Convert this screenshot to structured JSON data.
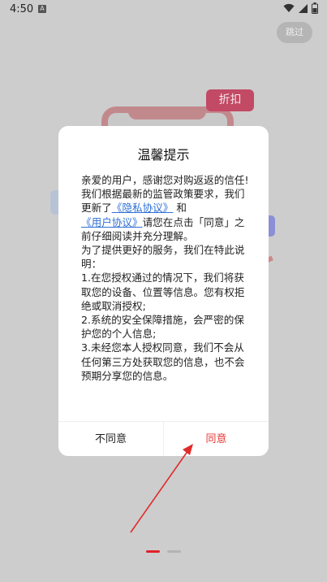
{
  "status_bar": {
    "time": "4:50",
    "notification_icon": "A"
  },
  "skip_label": "跳过",
  "discount_badge": "折扣",
  "dialog": {
    "title": "温馨提示",
    "p1": "亲爱的用户，感谢您对购返返的信任!",
    "p2_pre": "我们根据最新的监管政策要求，我们更新了",
    "privacy_link": "《隐私协议》",
    "and_word": "和",
    "user_link": "《用户协议》",
    "p2_post": "请您在点击「同意」之前仔细阅读并充分理解。",
    "p3": "为了提供更好的服务，我们在特此说明：",
    "item1": "1.在您授权通过的情况下，我们将获取您的设备、位置等信息。您有权拒绝或取消授权;",
    "item2": "2.系统的安全保障措施，会严密的保护您的个人信息;",
    "item3": "3.未经您本人授权同意，我们不会从任何第三方处获取您的信息，也不会预期分享您的信息。",
    "disagree_label": "不同意",
    "agree_label": "同意"
  },
  "colors": {
    "accent": "#e53935",
    "link": "#2e6fd6",
    "pager_active": "#e0222a"
  }
}
